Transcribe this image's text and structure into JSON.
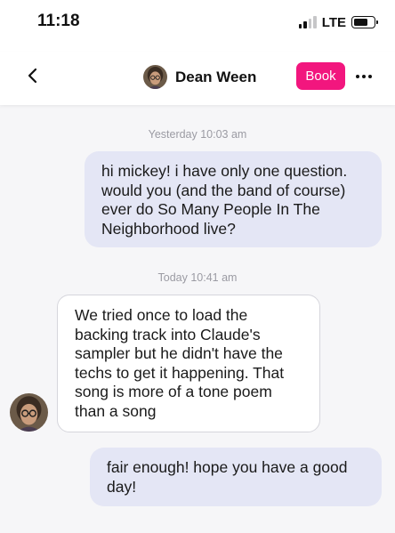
{
  "status_bar": {
    "time": "11:18",
    "network": "LTE",
    "battery_level": 0.7
  },
  "header": {
    "back_icon": "chevron-left-icon",
    "contact_name": "Dean Ween",
    "book_label": "Book",
    "more_icon": "more-horizontal-icon",
    "accent_color": "#f2167e"
  },
  "messages": [
    {
      "type": "timestamp",
      "text": "Yesterday 10:03 am"
    },
    {
      "type": "outgoing",
      "text": "hi mickey! i have only one question.\nwould you (and the band of course)\never do So Many People In The\nNeighborhood live?"
    },
    {
      "type": "timestamp",
      "text": "Today 10:41 am"
    },
    {
      "type": "incoming",
      "text": "We tried once to load the\nbacking track into Claude's\nsampler but he didn't have the\ntechs to get it happening. That\nsong is more of a tone poem\nthan a song"
    },
    {
      "type": "outgoing",
      "text": "fair enough! hope you have a good\nday!"
    }
  ]
}
